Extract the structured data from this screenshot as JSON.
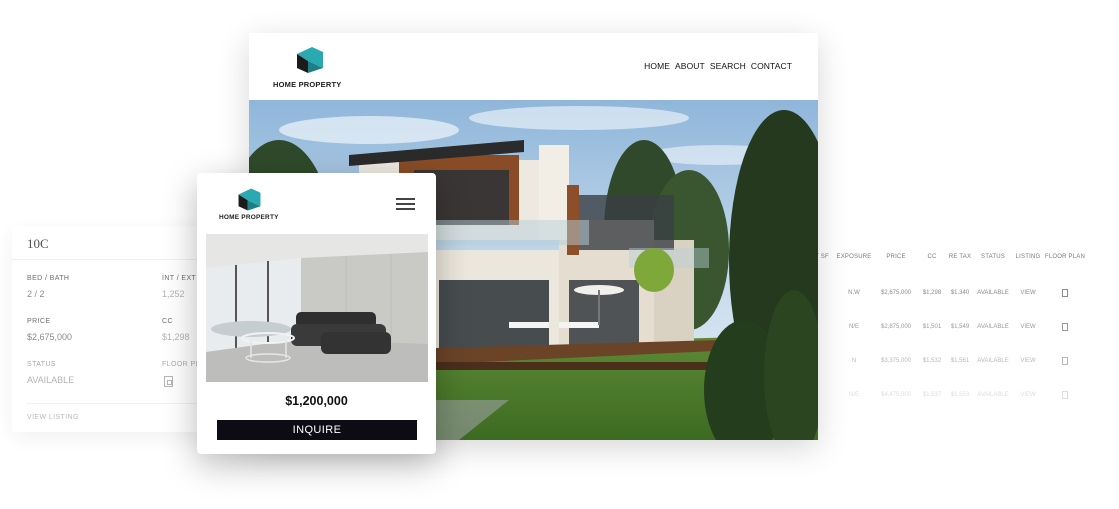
{
  "brand": {
    "name": "HOME PROPERTY",
    "accent": "#2aa9b0",
    "mark_dark": "#1b1b1b"
  },
  "desktop": {
    "nav": [
      "HOME",
      "ABOUT",
      "SEARCH",
      "CONTACT"
    ]
  },
  "mobile": {
    "price": "$1,200,000",
    "cta": "INQUIRE"
  },
  "listing_card": {
    "unit": "10C",
    "fields": [
      {
        "label": "BED / BATH",
        "value": "2 / 2"
      },
      {
        "label": "INT / EXT SF",
        "value": "1,252"
      },
      {
        "label": "PRICE",
        "value": "$2,675,000"
      },
      {
        "label": "CC",
        "value": "$1,298"
      },
      {
        "label": "STATUS",
        "value": "AVAILABLE"
      },
      {
        "label": "FLOOR PLAN",
        "value": ""
      }
    ],
    "link": "VIEW LISTING"
  },
  "listings_table": {
    "headers": [
      "T SF",
      "EXPOSURE",
      "PRICE",
      "CC",
      "RE TAX",
      "STATUS",
      "LISTING",
      "FLOOR PLAN"
    ],
    "rows": [
      [
        "",
        "N,W",
        "$2,675,000",
        "$1,298",
        "$1,340",
        "AVAILABLE",
        "VIEW"
      ],
      [
        "",
        "N/E",
        "$2,875,000",
        "$1,501",
        "$1,549",
        "AVAILABLE",
        "VIEW"
      ],
      [
        "",
        "N",
        "$3,375,000",
        "$1,532",
        "$1,561",
        "AVAILABLE",
        "VIEW"
      ],
      [
        "",
        "N/E",
        "$4,475,000",
        "$1,537",
        "$1,553",
        "AVAILABLE",
        "VIEW"
      ]
    ]
  }
}
